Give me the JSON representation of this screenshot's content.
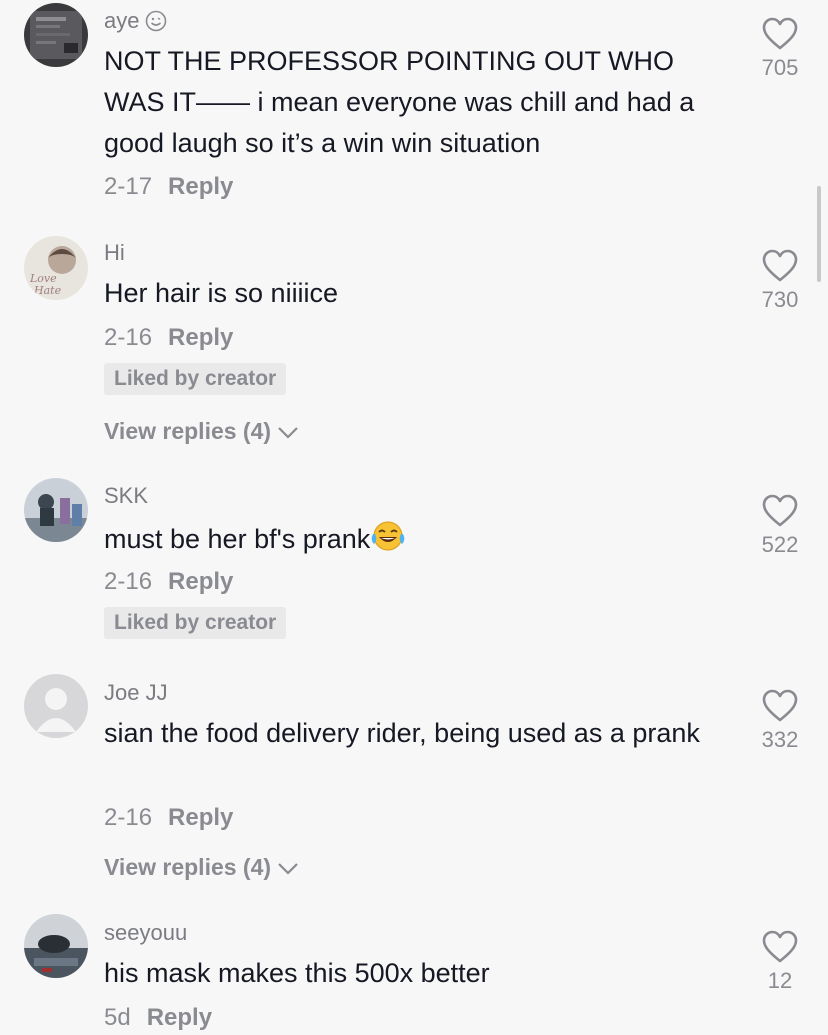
{
  "colors": {
    "background": "#f7f7f7",
    "primary_text": "#161823",
    "secondary_text": "#8a8b91",
    "badge_bg": "#e9e9ea"
  },
  "comments": [
    {
      "username": "aye",
      "username_icon": "smiley-face-icon",
      "text": "NOT THE PROFESSOR POINTING OUT WHO WAS IT—— i mean everyone was chill and had a good laugh so it’s a win win situation",
      "date": "2-17",
      "reply_label": "Reply",
      "likes": "705"
    },
    {
      "username": "Hi",
      "text": "Her hair is so niiiice",
      "date": "2-16",
      "reply_label": "Reply",
      "badge": "Liked by creator",
      "view_replies": "View replies (4)",
      "likes": "730"
    },
    {
      "username": "SKK",
      "text": "must be her bf's prank",
      "text_emoji": "laughing-crying-emoji",
      "date": "2-16",
      "reply_label": "Reply",
      "badge": "Liked by creator",
      "likes": "522"
    },
    {
      "username": "Joe JJ",
      "text": "sian the food delivery rider, being used as a prank",
      "date": "2-16",
      "reply_label": "Reply",
      "view_replies": "View replies (4)",
      "likes": "332"
    },
    {
      "username": "seeyouu",
      "text": "his mask makes this 500x better",
      "date": "5d",
      "reply_label": "Reply",
      "likes": "12"
    }
  ]
}
